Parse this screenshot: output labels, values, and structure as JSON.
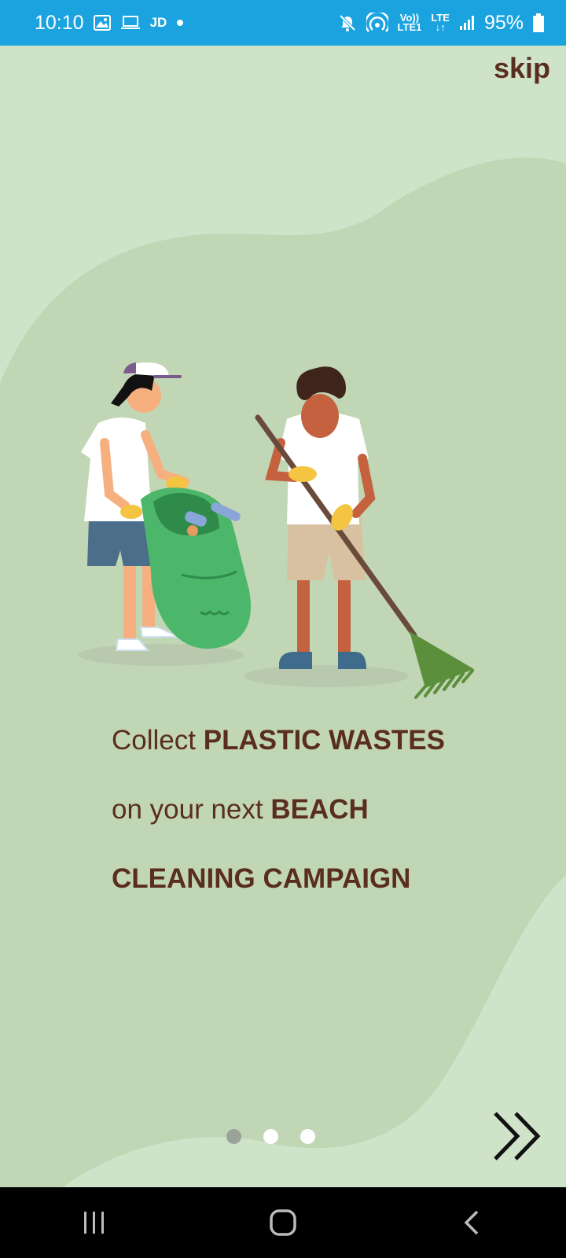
{
  "status_bar": {
    "time": "10:10",
    "carrier_text": "JD",
    "volte_top": "Vo))",
    "volte_bottom": "LTE1",
    "lte_label": "LTE",
    "battery": "95%"
  },
  "onboarding": {
    "skip_label": "skip",
    "line1_plain": "Collect ",
    "line1_bold": "PLASTIC WASTES",
    "line2_plain": "on your next ",
    "line2_bold": "BEACH",
    "line3_bold": "CLEANING CAMPAIGN",
    "page_indicator": {
      "total": 3,
      "current": 1
    }
  },
  "colors": {
    "status_bar_bg": "#1ba3e0",
    "background": "#cfe3c9",
    "blob": "#c1d6b5",
    "text_brown": "#5a2e1e",
    "dot_active": "#9aa39a",
    "dot_inactive": "#ffffff"
  },
  "icons": {
    "status": [
      "gallery-icon",
      "laptop-icon",
      "dot-icon",
      "mute-icon",
      "hotspot-icon",
      "signal-icon",
      "battery-icon"
    ],
    "next": "double-chevron-right-icon",
    "nav": [
      "recents-icon",
      "home-icon",
      "back-icon"
    ]
  }
}
